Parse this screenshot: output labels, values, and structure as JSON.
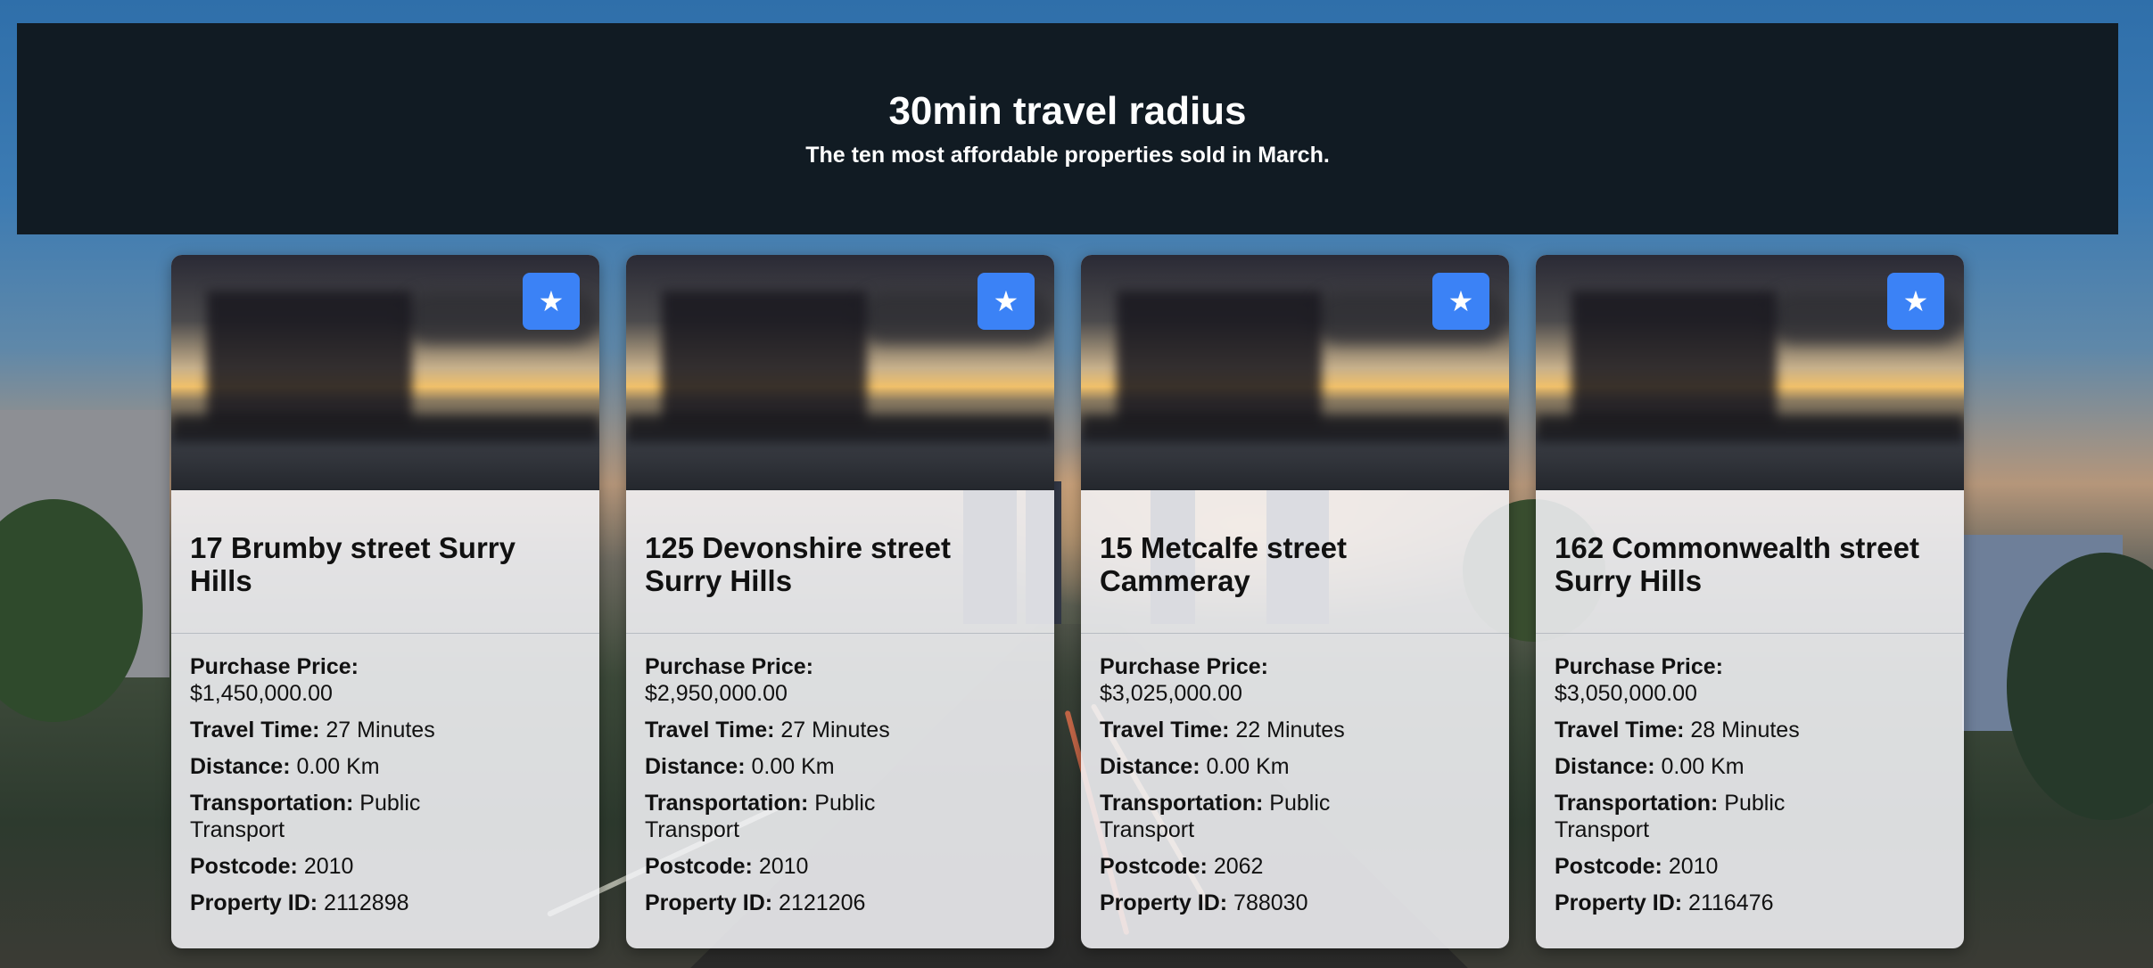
{
  "header": {
    "title": "30min travel radius",
    "subtitle": "The ten most affordable properties sold in March."
  },
  "labels": {
    "price": "Purchase Price:",
    "travel": "Travel Time:",
    "distance": "Distance:",
    "transport": "Transportation:",
    "postcode": "Postcode:",
    "property_id": "Property ID:"
  },
  "favorite_icon": "star-icon",
  "colors": {
    "banner_bg": "#111b23",
    "favorite_button": "#3b82f6"
  },
  "cards": [
    {
      "address": "17 Brumby street Surry Hills",
      "price": "$1,450,000.00",
      "travel": "27 Minutes",
      "distance": "0.00 Km",
      "transport": "Public Transport",
      "postcode": "2010",
      "property_id": "2112898"
    },
    {
      "address": "125 Devonshire street Surry Hills",
      "price": "$2,950,000.00",
      "travel": "27 Minutes",
      "distance": "0.00 Km",
      "transport": "Public Transport",
      "postcode": "2010",
      "property_id": "2121206"
    },
    {
      "address": "15 Metcalfe street Cammeray",
      "price": "$3,025,000.00",
      "travel": "22 Minutes",
      "distance": "0.00 Km",
      "transport": "Public Transport",
      "postcode": "2062",
      "property_id": "788030"
    },
    {
      "address": "162 Commonwealth street Surry Hills",
      "price": "$3,050,000.00",
      "travel": "28 Minutes",
      "distance": "0.00 Km",
      "transport": "Public Transport",
      "postcode": "2010",
      "property_id": "2116476"
    }
  ]
}
